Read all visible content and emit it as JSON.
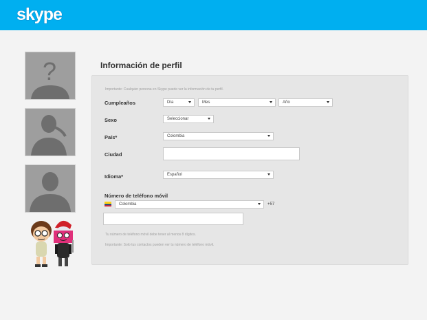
{
  "header": {
    "logo_text": "skype",
    "bg_color": "#00aff0"
  },
  "sidebar": {
    "avatars": [
      "unknown-user-icon",
      "female-user-icon",
      "male-user-icon"
    ],
    "mascots": "skype-mascots"
  },
  "profile": {
    "title": "Información de perfil",
    "notice": "Importante: Cualquier persona en Skype puede ver la información de tu perfil.",
    "birthday": {
      "label": "Cumpleaños",
      "day": "Día",
      "month": "Mes",
      "year": "Año"
    },
    "sex": {
      "label": "Sexo",
      "value": "Seleccionar"
    },
    "country": {
      "label": "País*",
      "value": "Colombia"
    },
    "city": {
      "label": "Ciudad",
      "value": ""
    },
    "language": {
      "label": "Idioma*",
      "value": "Español"
    },
    "mobile": {
      "label": "Número de teléfono móvil",
      "country": "Colombia",
      "code": "+57",
      "number": "",
      "hint": "Tu número de teléfono móvil debe tener al menos 8 dígitos.",
      "privacy": "Importante: Solo tus contactos pueden ver tu número de teléfono móvil."
    }
  }
}
